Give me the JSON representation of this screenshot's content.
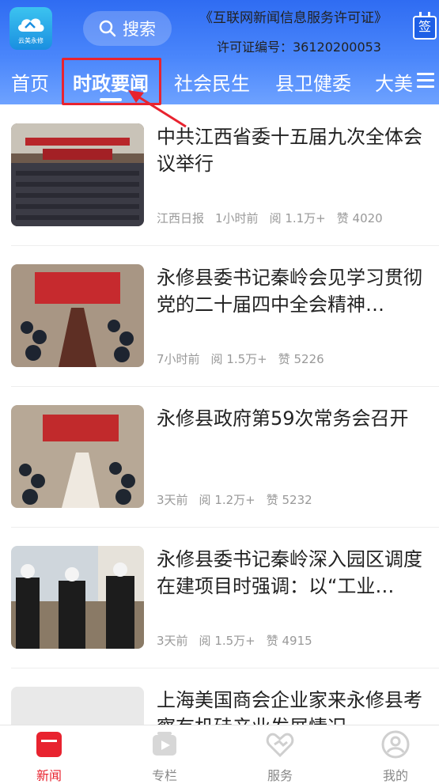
{
  "header": {
    "logo_text": "云美永修",
    "search_label": "搜索",
    "license_line1": "《互联网新闻信息服务许可证》",
    "license_line2": "许可证编号：36120200053",
    "sign_label": "签"
  },
  "tabs": [
    {
      "label": "首页"
    },
    {
      "label": "时政要闻"
    },
    {
      "label": "社会民生"
    },
    {
      "label": "县卫健委"
    },
    {
      "label": "大美"
    }
  ],
  "news": [
    {
      "title": "中共江西省委十五届九次全体会议举行",
      "source": "江西日报",
      "time": "1小时前",
      "reads": "阅 1.1万+",
      "likes": "赞 4020",
      "thumb": "meeting-hall"
    },
    {
      "title": "永修县委书记秦岭会见学习贯彻党的二十届四中全会精神…",
      "source": "",
      "time": "7小时前",
      "reads": "阅 1.5万+",
      "likes": "赞 5226",
      "thumb": "conference-table"
    },
    {
      "title": "永修县政府第59次常务会召开",
      "source": "",
      "time": "3天前",
      "reads": "阅 1.2万+",
      "likes": "赞 5232",
      "thumb": "conference-room"
    },
    {
      "title": "永修县委书记秦岭深入园区调度在建项目时强调：以“工业…",
      "source": "",
      "time": "3天前",
      "reads": "阅 1.5万+",
      "likes": "赞 4915",
      "thumb": "construction-site"
    },
    {
      "title": "上海美国商会企业家来永修县考察有机硅产业发展情况",
      "source": "",
      "time": "",
      "reads": "",
      "likes": "",
      "thumb": "blank"
    }
  ],
  "bottom_nav": [
    {
      "label": "新闻",
      "icon": "news-icon",
      "active": true
    },
    {
      "label": "专栏",
      "icon": "column-icon",
      "active": false
    },
    {
      "label": "服务",
      "icon": "service-icon",
      "active": false
    },
    {
      "label": "我的",
      "icon": "profile-icon",
      "active": false
    }
  ],
  "colors": {
    "accent": "#e8232f",
    "header": "#3f7cf7"
  }
}
